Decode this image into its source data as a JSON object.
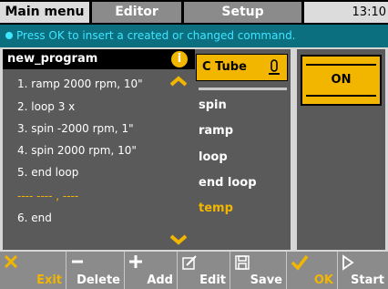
{
  "tabs": [
    {
      "label": "Main menu",
      "active": true
    },
    {
      "label": "Editor",
      "active": false
    },
    {
      "label": "Setup",
      "active": false
    }
  ],
  "clock": "13:10",
  "info_message": "Press OK to insert a created or changed command.",
  "program": {
    "title": "new_program",
    "lines": [
      "1. ramp 2000 rpm, 10\"",
      "2. loop 3 x",
      "3. spin -2000 rpm, 1\"",
      "4. spin 2000 rpm, 10\"",
      "5. end loop",
      "---- ---- , ----",
      "6. end"
    ]
  },
  "commands": {
    "selected": "C Tube",
    "items": [
      "spin",
      "ramp",
      "loop",
      "end loop",
      "temp"
    ]
  },
  "parameter": {
    "value": "ON"
  },
  "footer": [
    {
      "label": "Exit",
      "icon": "close-icon"
    },
    {
      "label": "Delete",
      "icon": "minus-icon"
    },
    {
      "label": "Add",
      "icon": "plus-icon"
    },
    {
      "label": "Edit",
      "icon": "edit-icon"
    },
    {
      "label": "Save",
      "icon": "save-icon"
    },
    {
      "label": "OK",
      "icon": "check-icon"
    },
    {
      "label": "Start",
      "icon": "play-icon"
    }
  ],
  "colors": {
    "accent": "#f2b600",
    "info_bar": "#0b6f80",
    "info_text": "#3fe6ff",
    "panel": "#5a5a5a"
  }
}
